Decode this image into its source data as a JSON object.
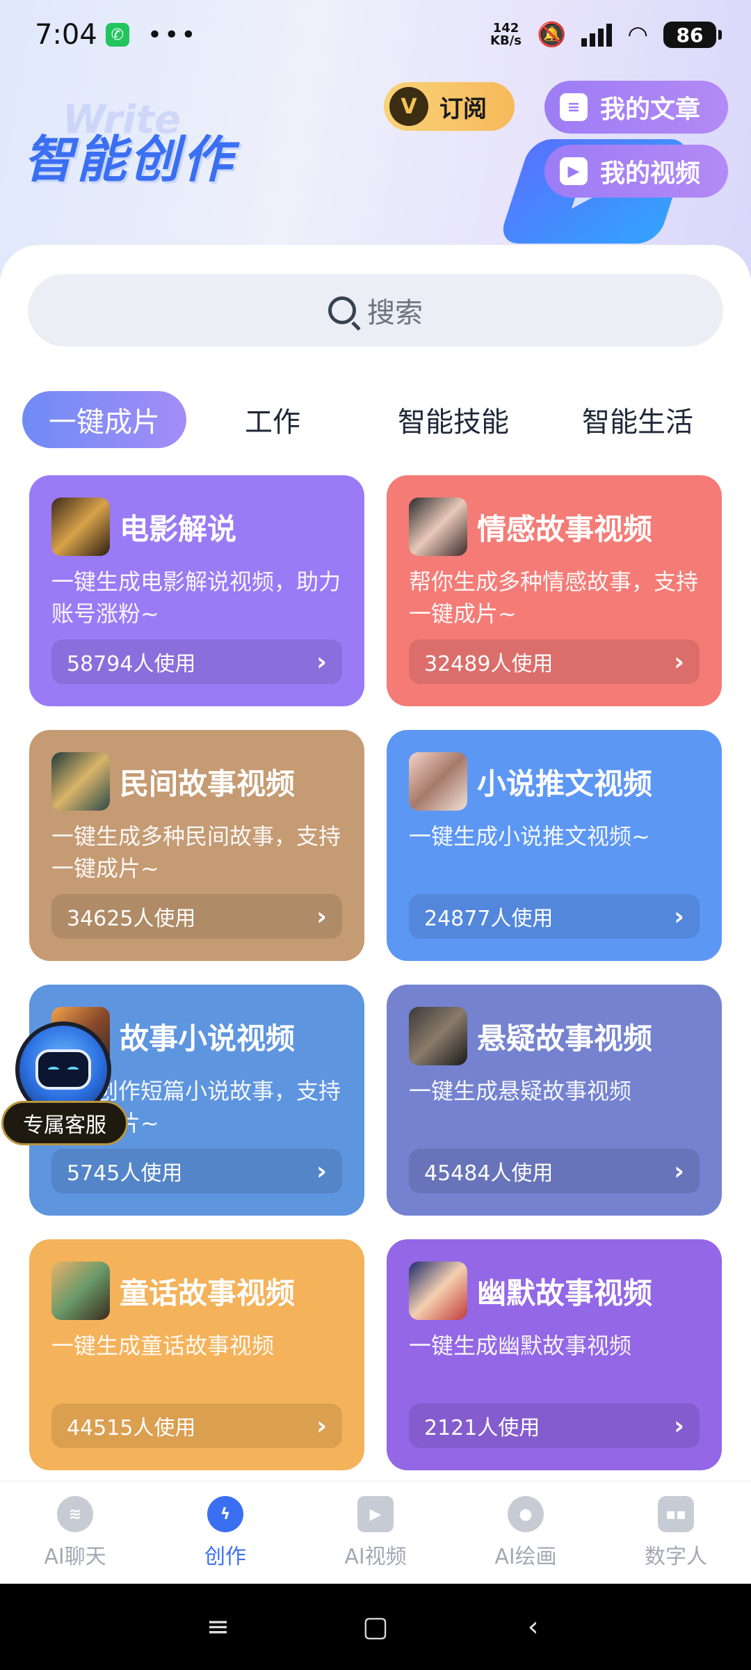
{
  "status_bar": {
    "time": "7:04",
    "net_speed_value": "142",
    "net_speed_unit": "KB/s",
    "battery": "86"
  },
  "header": {
    "brand": "智能创作",
    "subscribe_label": "订阅",
    "my_articles_label": "我的文章",
    "my_videos_label": "我的视频"
  },
  "search": {
    "placeholder": "搜索"
  },
  "tabs": [
    {
      "label": "一键成片",
      "active": true
    },
    {
      "label": "工作",
      "active": false
    },
    {
      "label": "智能技能",
      "active": false
    },
    {
      "label": "智能生活",
      "active": false
    }
  ],
  "cards": [
    {
      "title": "电影解说",
      "desc": "一键生成电影解说视频，助力账号涨粉~",
      "usage": "58794人使用",
      "color": "#9a7bf5"
    },
    {
      "title": "情感故事视频",
      "desc": "帮你生成多种情感故事，支持一键成片~",
      "usage": "32489人使用",
      "color": "#f47b76"
    },
    {
      "title": "民间故事视频",
      "desc": "一键生成多种民间故事，支持一键成片~",
      "usage": "34625人使用",
      "color": "#c59b73"
    },
    {
      "title": "小说推文视频",
      "desc": "一键生成小说推文视频~",
      "usage": "24877人使用",
      "color": "#5d97f4"
    },
    {
      "title": "故事小说视频",
      "desc": "主题创作短篇小说故事，支持一键成片~",
      "usage": "5745人使用",
      "color": "#5e95df"
    },
    {
      "title": "悬疑故事视频",
      "desc": "一键生成悬疑故事视频",
      "usage": "45484人使用",
      "color": "#7482cf"
    },
    {
      "title": "童话故事视频",
      "desc": "一键生成童话故事视频",
      "usage": "44515人使用",
      "color": "#f4b25a"
    },
    {
      "title": "幽默故事视频",
      "desc": "一键生成幽默故事视频",
      "usage": "2121人使用",
      "color": "#9367e6"
    }
  ],
  "service": {
    "label": "专属客服"
  },
  "bottom_nav": [
    {
      "label": "AI聊天",
      "icon": "chat-icon",
      "active": false
    },
    {
      "label": "创作",
      "icon": "lightning-icon",
      "active": true
    },
    {
      "label": "AI视频",
      "icon": "video-icon",
      "active": false
    },
    {
      "label": "AI绘画",
      "icon": "palette-icon",
      "active": false
    },
    {
      "label": "数字人",
      "icon": "robot-icon",
      "active": false
    }
  ]
}
